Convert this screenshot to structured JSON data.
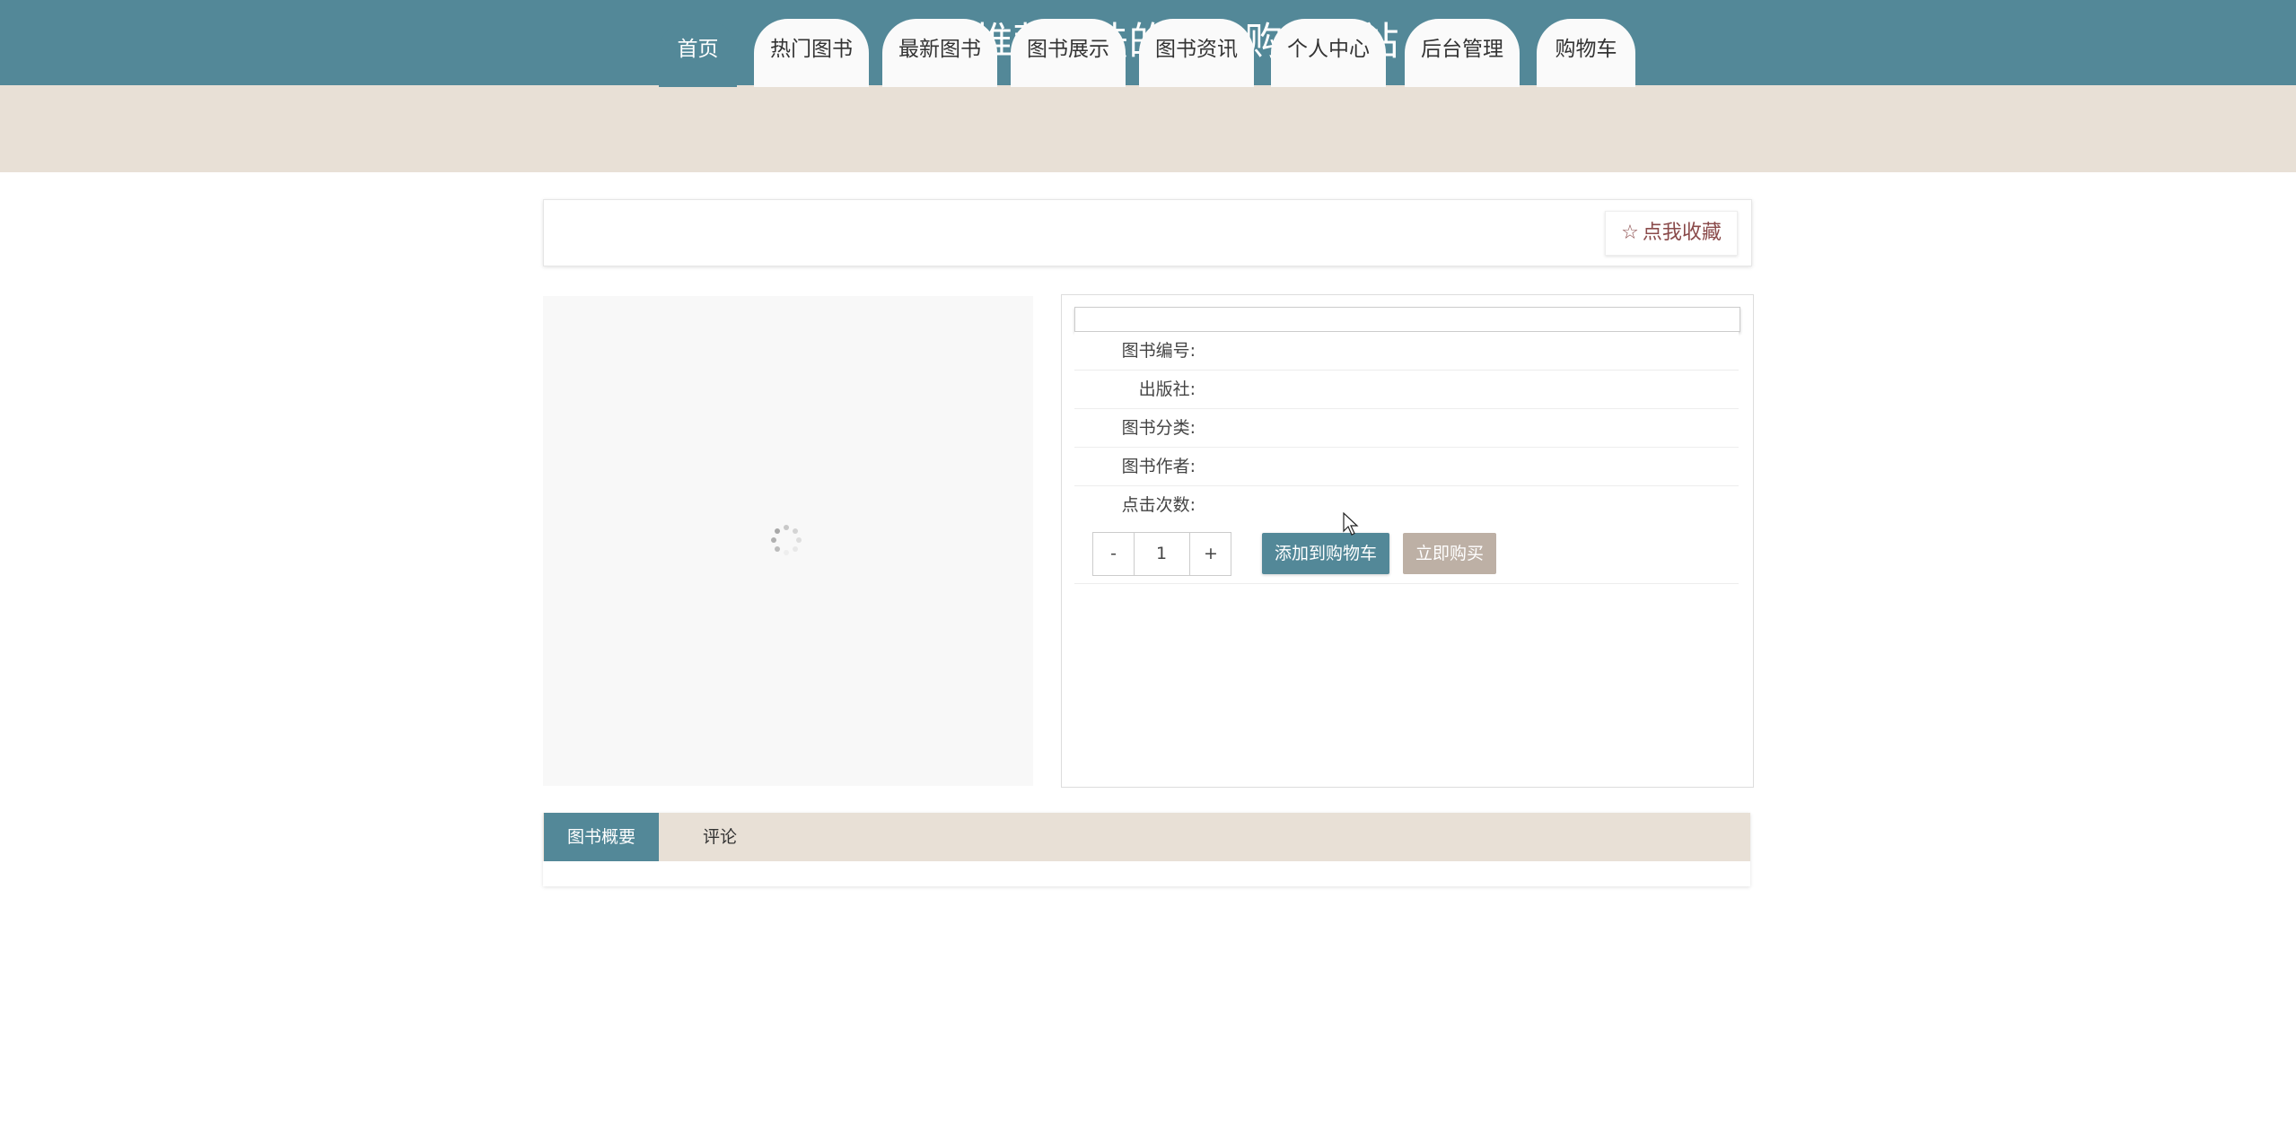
{
  "header": {
    "title": "基于推荐算法的图书购物网站"
  },
  "nav": {
    "items": [
      "首页",
      "热门图书",
      "最新图书",
      "图书展示",
      "图书资讯",
      "个人中心",
      "后台管理",
      "购物车"
    ],
    "active_index": 0
  },
  "favorite": {
    "label": "点我收藏",
    "icon": "star-outline-icon"
  },
  "details": {
    "labels": [
      "图书编号:",
      "出版社:",
      "图书分类:",
      "图书作者:",
      "点击次数:"
    ]
  },
  "quantity": {
    "minus": "-",
    "value": "1",
    "plus": "+"
  },
  "actions": {
    "add_to_cart": "添加到购物车",
    "buy_now": "立即购买"
  },
  "tabs": {
    "summary": "图书概要",
    "comment": "评论"
  },
  "colors": {
    "primary": "#538898",
    "beige": "#e8e0d6",
    "buy": "#bdb0a5"
  }
}
